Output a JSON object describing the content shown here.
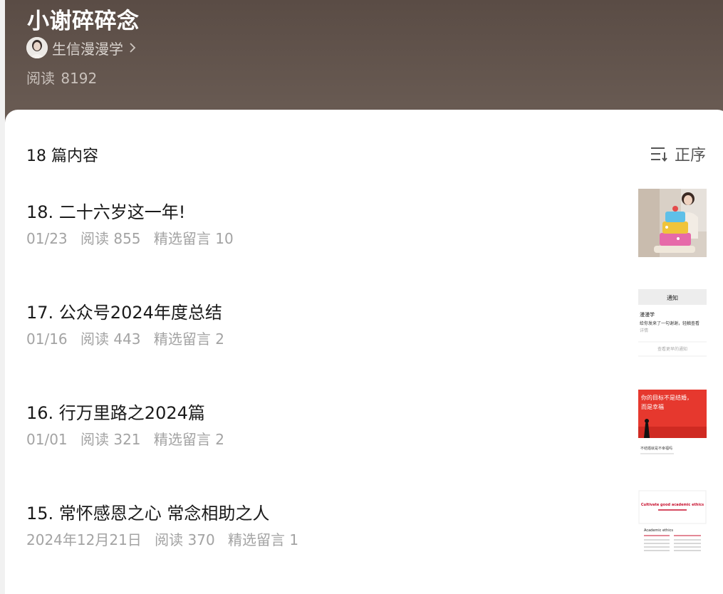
{
  "header": {
    "title": "小谢碎碎念",
    "author": "生信漫漫学",
    "reads_label": "阅读",
    "reads_value": "8192"
  },
  "list": {
    "count_label": "18 篇内容",
    "sort_label": "正序"
  },
  "articles": [
    {
      "title": "18. 二十六岁这一年!",
      "date": "01/23",
      "reads": "阅读 855",
      "comments": "精选留言 10"
    },
    {
      "title": "17. 公众号2024年度总结",
      "date": "01/16",
      "reads": "阅读 443",
      "comments": "精选留言 2",
      "thumb": {
        "notice": "通知",
        "account": "漫漫学",
        "message": "给你发来了一句谢谢，轻触查看",
        "sub": "详情",
        "link": "查看更早的通知"
      }
    },
    {
      "title": "16. 行万里路之2024篇",
      "date": "01/01",
      "reads": "阅读 321",
      "comments": "精选留言 2",
      "thumb": {
        "line1": "你的目标不是结婚，",
        "line2": "而是幸福",
        "caption": "不结婚就是不幸福吗"
      }
    },
    {
      "title": "15. 常怀感恩之心 常念相助之人",
      "date": "2024年12月21日",
      "reads": "阅读 370",
      "comments": "精选留言 1",
      "thumb": {
        "heading": "Cultivate good academic ethics",
        "sub": "Academic ethics"
      }
    }
  ]
}
